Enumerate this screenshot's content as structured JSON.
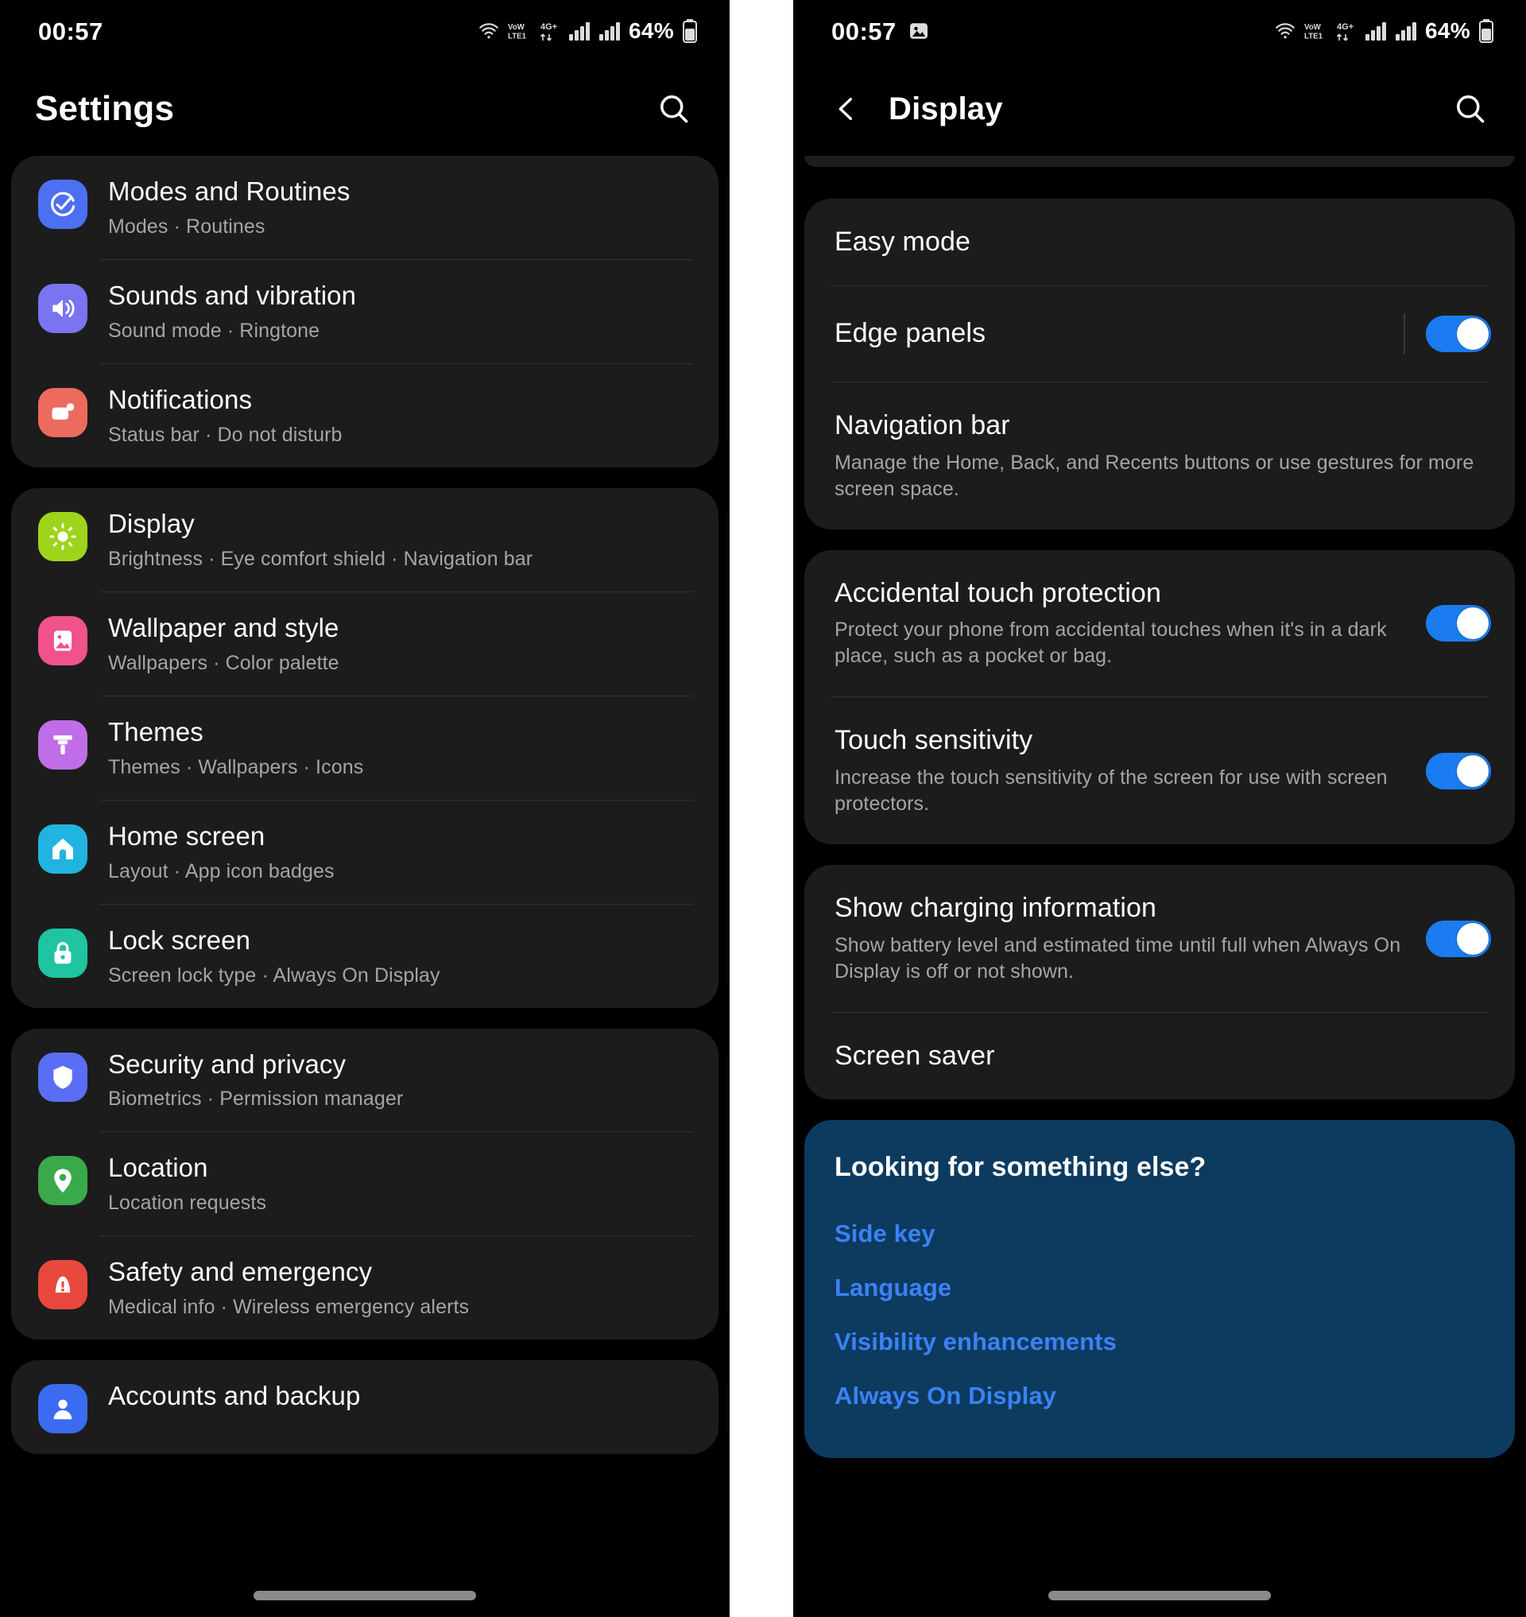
{
  "left_phone": {
    "status_bar": {
      "clock": "00:57",
      "battery_percent": "64%",
      "icons": [
        "nfc-icon",
        "vowifi-icon",
        "volte-icon",
        "signal-bars-icon",
        "signal-bars-icon",
        "battery-icon"
      ]
    },
    "app_bar": {
      "title": "Settings",
      "search_icon": "search-icon"
    },
    "groups": [
      {
        "id": "group-modes",
        "items": [
          {
            "title": "Modes and Routines",
            "subtitle": "Modes  ·  Routines",
            "icon": "modes-routines-icon",
            "icon_color": "#4d6ff2"
          },
          {
            "title": "Sounds and vibration",
            "subtitle": "Sound mode  ·  Ringtone",
            "icon": "sound-volume-icon",
            "icon_color": "#7a74f0"
          },
          {
            "title": "Notifications",
            "subtitle": "Status bar  ·  Do not disturb",
            "icon": "notifications-icon",
            "icon_color": "#ec6b5e"
          }
        ]
      },
      {
        "id": "group-display",
        "items": [
          {
            "title": "Display",
            "subtitle": "Brightness  ·  Eye comfort shield  ·  Navigation bar",
            "icon": "brightness-icon",
            "icon_color": "#9ed419"
          },
          {
            "title": "Wallpaper and style",
            "subtitle": "Wallpapers  ·  Color palette",
            "icon": "wallpaper-icon",
            "icon_color": "#f0528c"
          },
          {
            "title": "Themes",
            "subtitle": "Themes  ·  Wallpapers  ·  Icons",
            "icon": "themes-brush-icon",
            "icon_color": "#c06de8"
          },
          {
            "title": "Home screen",
            "subtitle": "Layout  ·  App icon badges",
            "icon": "home-icon",
            "icon_color": "#21b4e0"
          },
          {
            "title": "Lock screen",
            "subtitle": "Screen lock type  ·  Always On Display",
            "icon": "lock-icon",
            "icon_color": "#1fc4a0"
          }
        ]
      },
      {
        "id": "group-security",
        "items": [
          {
            "title": "Security and privacy",
            "subtitle": "Biometrics  ·  Permission manager",
            "icon": "shield-icon",
            "icon_color": "#5a6ef5"
          },
          {
            "title": "Location",
            "subtitle": "Location requests",
            "icon": "location-pin-icon",
            "icon_color": "#39a94b"
          },
          {
            "title": "Safety and emergency",
            "subtitle": "Medical info  ·  Wireless emergency alerts",
            "icon": "emergency-alert-icon",
            "icon_color": "#e9483c"
          }
        ]
      },
      {
        "id": "group-accounts",
        "items": [
          {
            "title": "Accounts and backup",
            "subtitle": "",
            "icon": "accounts-backup-icon",
            "icon_color": "#3a6bf0"
          }
        ]
      }
    ]
  },
  "right_phone": {
    "status_bar": {
      "clock": "00:57",
      "battery_percent": "64%",
      "left_icon": "screenshot-image-icon",
      "icons": [
        "nfc-icon",
        "vowifi-icon",
        "volte-icon",
        "signal-bars-icon",
        "signal-bars-icon",
        "battery-icon"
      ]
    },
    "app_bar": {
      "back_icon": "chevron-left-icon",
      "title": "Display",
      "search_icon": "search-icon"
    },
    "groups": [
      {
        "id": "group-mode-nav",
        "items": [
          {
            "title": "Easy mode",
            "subtitle": "",
            "toggle": null
          },
          {
            "title": "Edge panels",
            "subtitle": "",
            "toggle": "on"
          },
          {
            "title": "Navigation bar",
            "subtitle": "Manage the Home, Back, and Recents buttons or use gestures for more screen space.",
            "toggle": null
          }
        ]
      },
      {
        "id": "group-touch",
        "items": [
          {
            "title": "Accidental touch protection",
            "subtitle": "Protect your phone from accidental touches when it's in a dark place, such as a pocket or bag.",
            "toggle": "on"
          },
          {
            "title": "Touch sensitivity",
            "subtitle": "Increase the touch sensitivity of the screen for use with screen protectors.",
            "toggle": "on"
          }
        ]
      },
      {
        "id": "group-charging",
        "items": [
          {
            "title": "Show charging information",
            "subtitle": "Show battery level and estimated time until full when Always On Display is off or not shown.",
            "toggle": "on"
          },
          {
            "title": "Screen saver",
            "subtitle": "",
            "toggle": null
          }
        ]
      }
    ],
    "info_card": {
      "title": "Looking for something else?",
      "links": [
        "Side key",
        "Language",
        "Visibility enhancements",
        "Always On Display"
      ],
      "bg_color": "#0d3b60",
      "link_color": "#3b82f6"
    }
  },
  "theme": {
    "background": "#000000",
    "card_background": "#1c1c1c",
    "primary_text": "#ffffff",
    "secondary_text": "#a5a5a5",
    "toggle_on_color": "#1a7cf0",
    "divider_color": "#333333"
  }
}
